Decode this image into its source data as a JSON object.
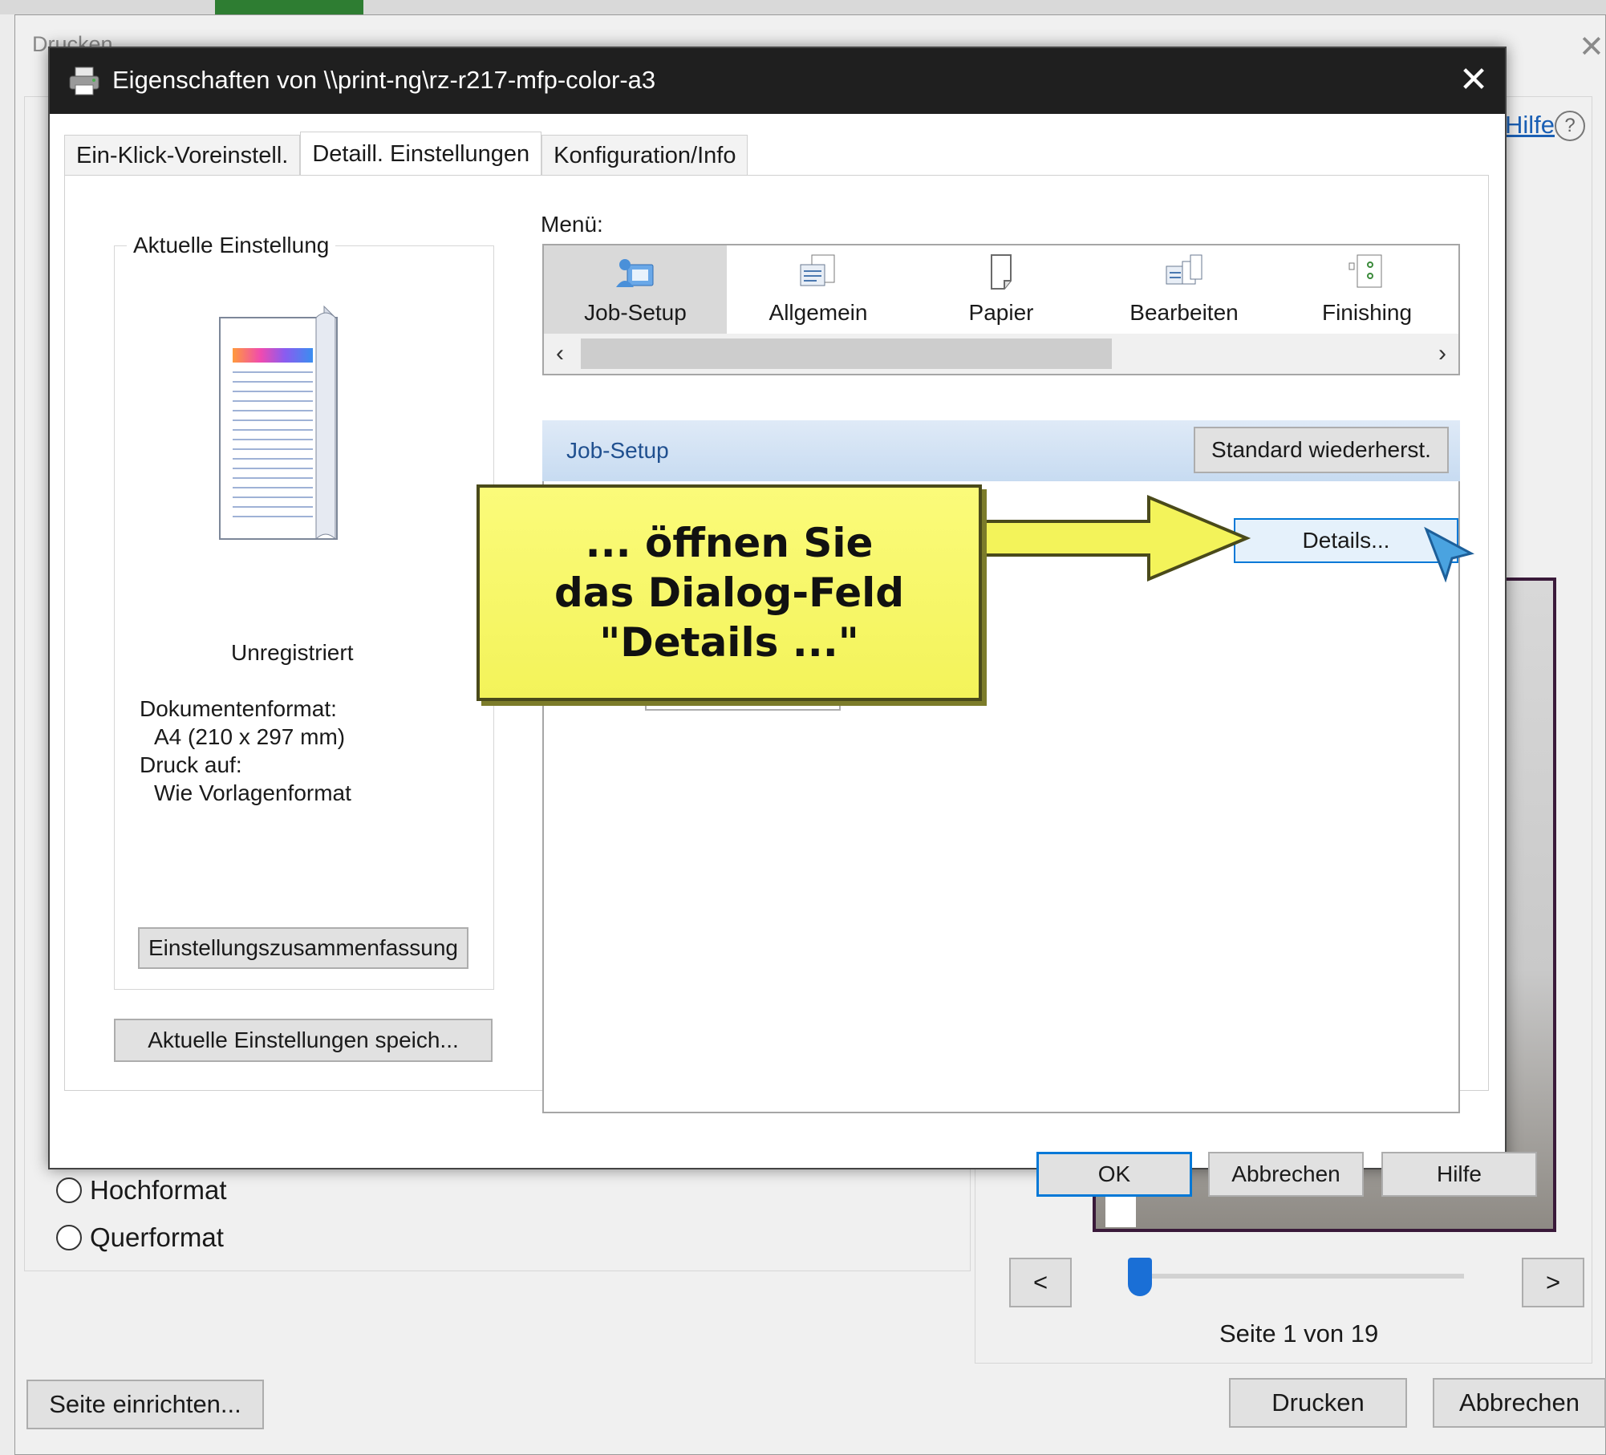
{
  "background_dialog": {
    "title": "Drucken",
    "help_link": "Hilfe",
    "orientation_options": [
      "Hochformat",
      "Querformat"
    ],
    "prev_label": "<",
    "next_label": ">",
    "page_info": "Seite 1 von 19",
    "page_setup_button": "Seite einrichten...",
    "print_button": "Drucken",
    "cancel_button": "Abbrechen"
  },
  "dialog": {
    "title": "Eigenschaften von \\\\print-ng\\rz-r217-mfp-color-a3",
    "tabs": [
      {
        "label": "Ein-Klick-Voreinstell."
      },
      {
        "label": "Detaill. Einstellungen"
      },
      {
        "label": "Konfiguration/Info"
      }
    ],
    "active_tab": "Detaill. Einstellungen",
    "current_settings": {
      "group_label": "Aktuelle Einstellung",
      "registration": "Unregistriert",
      "doc_format_label": "Dokumentenformat:",
      "doc_format_value": "A4 (210 x 297 mm)",
      "print_on_label": "Druck auf:",
      "print_on_value": "Wie Vorlagenformat",
      "summary_button": "Einstellungszusammenfassung",
      "save_button": "Aktuelle Einstellungen speich..."
    },
    "menu": {
      "label": "Menü:",
      "items": [
        {
          "label": "Job-Setup",
          "icon": "job-setup-icon"
        },
        {
          "label": "Allgemein",
          "icon": "general-icon"
        },
        {
          "label": "Papier",
          "icon": "paper-icon"
        },
        {
          "label": "Bearbeiten",
          "icon": "edit-icon"
        },
        {
          "label": "Finishing",
          "icon": "finishing-icon"
        }
      ],
      "active": "Job-Setup"
    },
    "section": {
      "title": "Job-Setup",
      "restore_button": "Standard wiederherst.",
      "details_button": "Details..."
    },
    "buttons": {
      "ok": "OK",
      "cancel": "Abbrechen",
      "help": "Hilfe"
    }
  },
  "annotation": {
    "text": "... öffnen Sie\ndas Dialog-Feld\n\"Details ...\"",
    "color": "#f5f562"
  },
  "colors": {
    "title_bar": "#1f1f1f",
    "accent": "#0078d7",
    "section_bar": "#c7dbf1"
  }
}
